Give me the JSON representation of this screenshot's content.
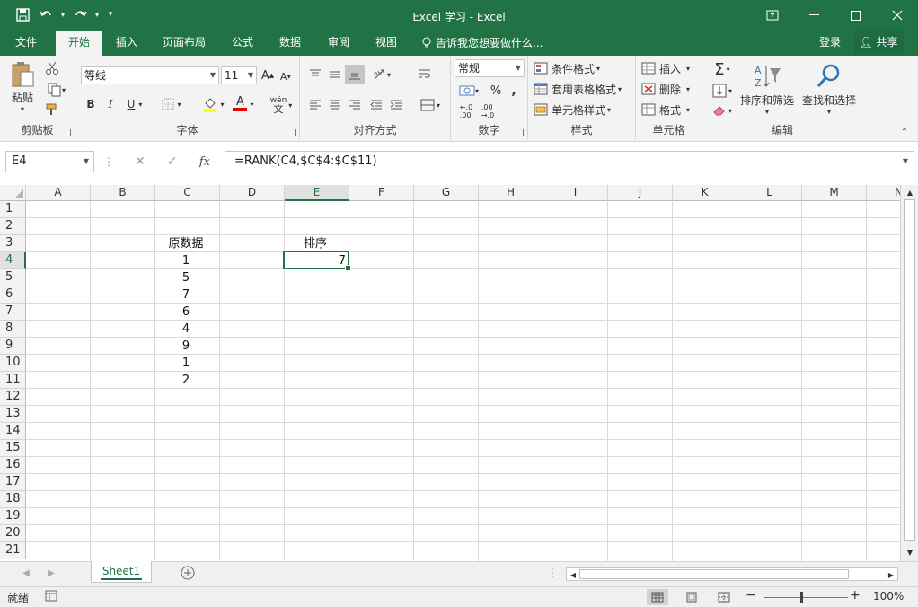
{
  "window": {
    "title": "Excel 学习 - Excel"
  },
  "qat": {
    "save_icon": "save-icon",
    "undo_icon": "undo-icon",
    "redo_icon": "redo-icon"
  },
  "tabs": [
    {
      "label": "文件"
    },
    {
      "label": "开始"
    },
    {
      "label": "插入"
    },
    {
      "label": "页面布局"
    },
    {
      "label": "公式"
    },
    {
      "label": "数据"
    },
    {
      "label": "审阅"
    },
    {
      "label": "视图"
    }
  ],
  "tell_me": "告诉我您想要做什么...",
  "login": "登录",
  "share": "共享",
  "ribbon": {
    "clipboard": {
      "label": "剪贴板",
      "paste": "粘贴"
    },
    "font": {
      "label": "字体",
      "font_name": "等线",
      "font_size": "11",
      "bold": "B",
      "italic": "I",
      "underline": "U",
      "grow": "A",
      "shrink": "A",
      "font_color_letter": "A",
      "wen": "wén"
    },
    "alignment": {
      "label": "对齐方式"
    },
    "number": {
      "label": "数字",
      "format": "常规",
      "percent": "%",
      "comma": ","
    },
    "styles": {
      "label": "样式",
      "conditional": "条件格式",
      "table": "套用表格格式",
      "cell_styles": "单元格样式"
    },
    "cells": {
      "label": "单元格",
      "insert": "插入",
      "delete": "删除",
      "format": "格式"
    },
    "editing": {
      "label": "编辑",
      "sort_filter": "排序和筛选",
      "find_select": "查找和选择"
    }
  },
  "formula_bar": {
    "name_box": "E4",
    "fx": "fx",
    "formula": "=RANK(C4,$C$4:$C$11)"
  },
  "grid": {
    "columns": [
      "A",
      "B",
      "C",
      "D",
      "E",
      "F",
      "G",
      "H",
      "I",
      "J",
      "K",
      "L",
      "M",
      "N"
    ],
    "rows": [
      "1",
      "2",
      "3",
      "4",
      "5",
      "6",
      "7",
      "8",
      "9",
      "10",
      "11",
      "12",
      "13",
      "14",
      "15",
      "16",
      "17",
      "18",
      "19",
      "20",
      "21"
    ],
    "selected_cell": "E4",
    "cells": {
      "C3": "原数据",
      "E3": "排序",
      "C4": "1",
      "C5": "5",
      "C6": "7",
      "C7": "6",
      "C8": "4",
      "C9": "9",
      "C10": "1",
      "C11": "2",
      "E4": "7"
    }
  },
  "sheet_tabs": [
    {
      "label": "Sheet1"
    }
  ],
  "status": {
    "ready": "就绪",
    "zoom": "100%"
  },
  "colors": {
    "accent": "#217346",
    "ribbon_bg": "#f3f3f3"
  }
}
